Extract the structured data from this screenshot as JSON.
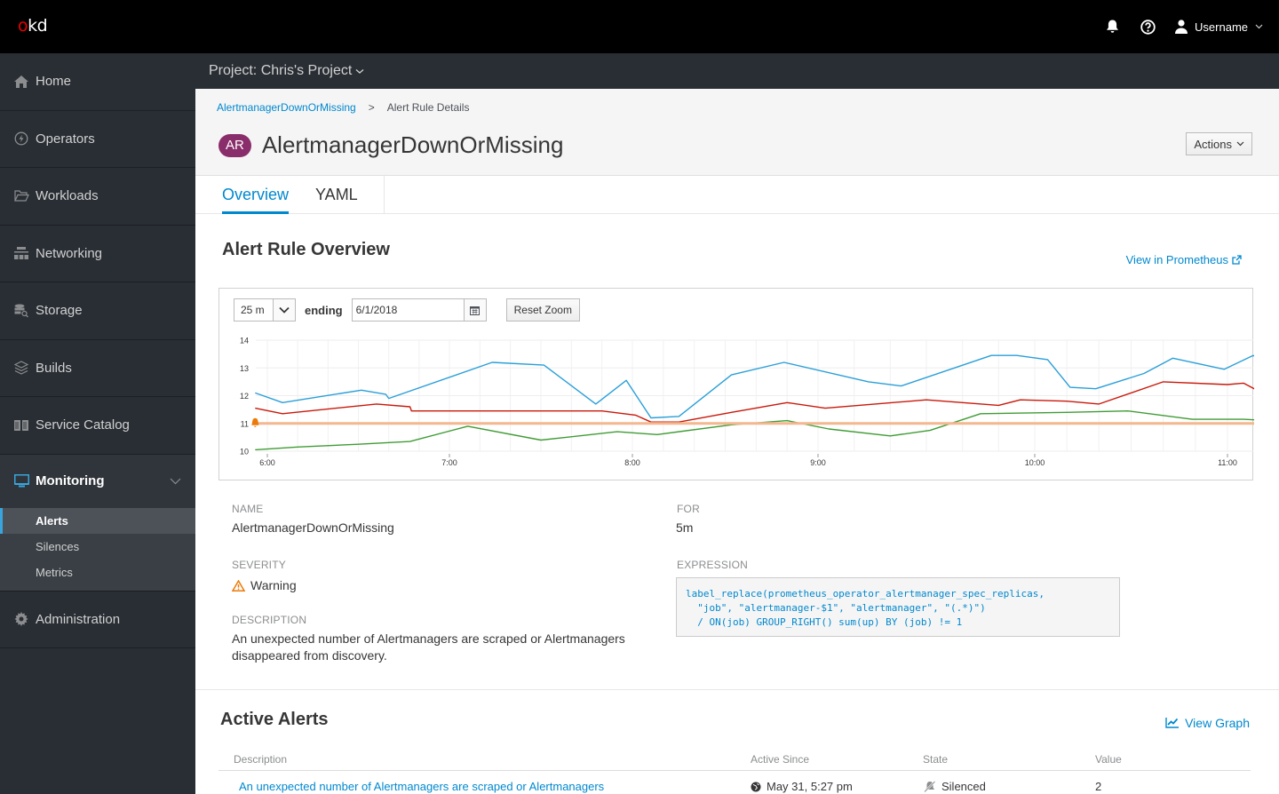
{
  "masthead": {
    "logo_o": "o",
    "logo_rest": "kd",
    "notifications_icon": "bell-icon",
    "help_icon": "question-circle-icon",
    "user_icon": "user-icon",
    "username": "Username"
  },
  "project_bar": {
    "label": "Project: Chris's Project"
  },
  "sidebar": {
    "items": [
      {
        "label": "Home",
        "icon": "home-icon"
      },
      {
        "label": "Operators",
        "icon": "bolt-icon"
      },
      {
        "label": "Workloads",
        "icon": "folder-open-icon"
      },
      {
        "label": "Networking",
        "icon": "sitemap-icon"
      },
      {
        "label": "Storage",
        "icon": "database-icon"
      },
      {
        "label": "Builds",
        "icon": "layers-icon"
      },
      {
        "label": "Service Catalog",
        "icon": "book-icon"
      },
      {
        "label": "Monitoring",
        "icon": "monitor-icon",
        "expanded": true
      },
      {
        "label": "Administration",
        "icon": "gear-icon"
      }
    ],
    "monitoring_subitems": [
      {
        "label": "Alerts",
        "active": true
      },
      {
        "label": "Silences",
        "active": false
      },
      {
        "label": "Metrics",
        "active": false
      }
    ]
  },
  "breadcrumb": {
    "parent": "AlertmanagerDownOrMissing",
    "separator": ">",
    "current": "Alert Rule Details"
  },
  "header": {
    "badge": "AR",
    "title": "AlertmanagerDownOrMissing",
    "actions_label": "Actions"
  },
  "tabs": [
    {
      "label": "Overview",
      "active": true
    },
    {
      "label": "YAML",
      "active": false
    }
  ],
  "overview": {
    "title": "Alert Rule Overview",
    "prometheus_link": "View in Prometheus",
    "controls": {
      "span_value": "25 m",
      "ending_label": "ending",
      "date_value": "6/1/2018",
      "reset_label": "Reset Zoom"
    },
    "fields": {
      "name_label": "Name",
      "name_value": "AlertmanagerDownOrMissing",
      "severity_label": "Severity",
      "severity_value": "Warning",
      "description_label": "Description",
      "description_value": "An unexpected number of Alertmanagers are scraped or Alertmanagers disappeared from discovery.",
      "for_label": "For",
      "for_value": "5m",
      "expression_label": "Expression",
      "expression_value": "label_replace(prometheus_operator_alertmanager_spec_replicas,\n  \"job\", \"alertmanager-$1\", \"alertmanager\", \"(.*)\")\n  / ON(job) GROUP_RIGHT() sum(up) BY (job) != 1"
    }
  },
  "active_alerts": {
    "title": "Active Alerts",
    "view_graph_label": "View Graph",
    "columns": [
      "Description",
      "Active Since",
      "State",
      "Value"
    ],
    "rows": [
      {
        "description": "An unexpected number of Alertmanagers are scraped or Alertmanagers",
        "active_since": "May 31, 5:27 pm",
        "state": "Silenced",
        "value": "2"
      }
    ]
  },
  "colors": {
    "accent": "#0088ce",
    "badge": "#8a2d6b",
    "warning": "#ec7a08",
    "series_blue": "#2a9fd8",
    "series_red": "#c9190b",
    "series_green": "#3f9c35",
    "threshold": "#f4b78f"
  },
  "chart_data": {
    "type": "line",
    "title": "",
    "xlabel": "",
    "ylabel": "",
    "x_ticks": [
      "6:00",
      "7:00",
      "8:00",
      "9:00",
      "10:00",
      "11:00"
    ],
    "y_ticks": [
      10,
      11,
      12,
      13,
      14
    ],
    "ylim": [
      10,
      14
    ],
    "xlim_minutes_from_6": [
      -4,
      128
    ],
    "grid": true,
    "x_unit": "minutes after 6:00",
    "series": [
      {
        "name": "blue",
        "points": [
          [
            -4,
            12.1
          ],
          [
            5,
            11.75
          ],
          [
            31,
            12.2
          ],
          [
            39,
            12.05
          ],
          [
            40,
            11.9
          ],
          [
            74,
            13.2
          ],
          [
            91,
            13.1
          ],
          [
            108,
            11.7
          ],
          [
            118,
            12.55
          ],
          [
            126,
            11.2
          ],
          [
            135,
            11.25
          ],
          [
            152,
            12.75
          ],
          [
            169,
            13.2
          ],
          [
            194,
            12.5
          ],
          [
            203,
            12.35
          ],
          [
            228,
            13.45
          ],
          [
            235,
            13.45
          ],
          [
            244,
            13.3
          ],
          [
            251,
            12.3
          ],
          [
            259,
            12.25
          ],
          [
            274,
            12.8
          ],
          [
            283,
            13.35
          ],
          [
            299,
            12.95
          ],
          [
            308,
            13.45
          ],
          [
            314,
            13.1
          ]
        ]
      },
      {
        "name": "red",
        "points": [
          [
            -4,
            11.55
          ],
          [
            5,
            11.35
          ],
          [
            36,
            11.7
          ],
          [
            47,
            11.6
          ],
          [
            47.5,
            11.45
          ],
          [
            110,
            11.45
          ],
          [
            121,
            11.3
          ],
          [
            126,
            11.05
          ],
          [
            135,
            11.05
          ],
          [
            152,
            11.4
          ],
          [
            170,
            11.75
          ],
          [
            182,
            11.55
          ],
          [
            210,
            11.85
          ],
          [
            230,
            11.65
          ],
          [
            236,
            11.85
          ],
          [
            250,
            11.8
          ],
          [
            260,
            11.7
          ],
          [
            280,
            12.5
          ],
          [
            300,
            12.4
          ],
          [
            305,
            12.45
          ],
          [
            314,
            11.9
          ]
        ]
      },
      {
        "name": "green",
        "points": [
          [
            -4,
            10.05
          ],
          [
            10,
            10.15
          ],
          [
            30,
            10.25
          ],
          [
            47,
            10.35
          ],
          [
            66,
            10.9
          ],
          [
            90,
            10.4
          ],
          [
            115,
            10.7
          ],
          [
            128,
            10.6
          ],
          [
            152,
            10.95
          ],
          [
            170,
            11.1
          ],
          [
            183,
            10.8
          ],
          [
            200,
            10.55
          ],
          [
            211,
            10.75
          ],
          [
            225,
            11.35
          ],
          [
            250,
            11.4
          ],
          [
            269,
            11.45
          ],
          [
            289,
            11.15
          ],
          [
            305,
            11.15
          ],
          [
            314,
            11.1
          ]
        ]
      },
      {
        "name": "threshold",
        "points": [
          [
            -4,
            11.0
          ],
          [
            314,
            11.0
          ]
        ]
      }
    ],
    "annotations": [
      {
        "type": "alert-bell-marker",
        "x": -4,
        "y": 11.0
      }
    ]
  }
}
